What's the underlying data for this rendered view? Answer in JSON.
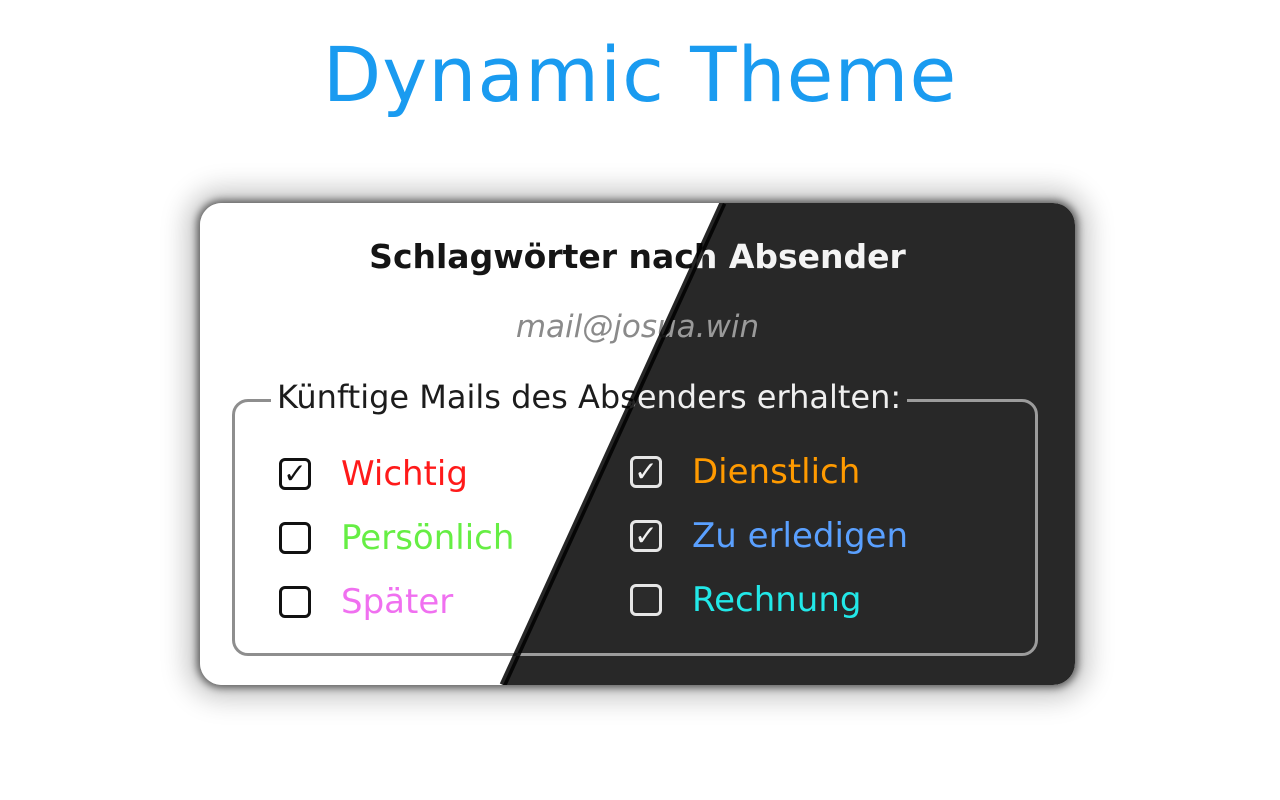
{
  "headline": {
    "text": "Dynamic Theme",
    "color": "#1a9bf0"
  },
  "theme": {
    "light_bg": "#ffffff",
    "dark_bg": "#282828"
  },
  "dialog": {
    "title": "Schlagwörter nach Absender",
    "sender_email": "mail@josua.win",
    "group_legend": "Künftige Mails des Absenders erhalten:",
    "checkmark_glyph": "✓",
    "tags": [
      {
        "label": "Wichtig",
        "checked": true,
        "color": "#ff1a1a",
        "icon": "checkbox-checked"
      },
      {
        "label": "Persönlich",
        "checked": false,
        "color": "#66ee44",
        "icon": "checkbox-empty"
      },
      {
        "label": "Später",
        "checked": false,
        "color": "#f070f0",
        "icon": "checkbox-empty"
      },
      {
        "label": "Dienstlich",
        "checked": true,
        "color": "#ff9a00",
        "icon": "checkbox-checked"
      },
      {
        "label": "Zu erledigen",
        "checked": true,
        "color": "#5aa0ff",
        "icon": "checkbox-checked"
      },
      {
        "label": "Rechnung",
        "checked": false,
        "color": "#22e8e8",
        "icon": "checkbox-empty"
      }
    ]
  }
}
